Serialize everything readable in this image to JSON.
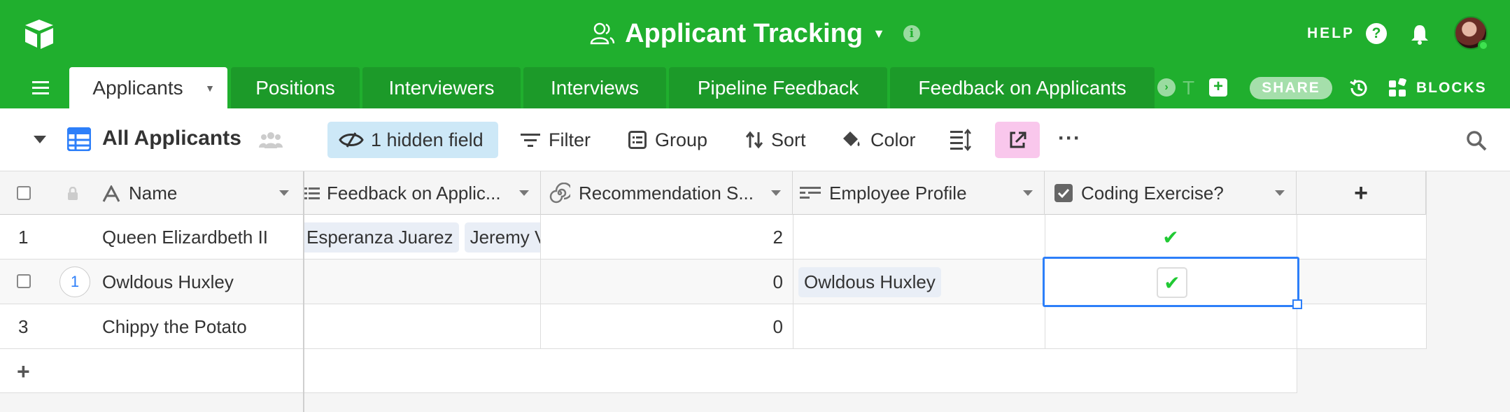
{
  "header": {
    "title": "Applicant Tracking",
    "help_label": "HELP",
    "share_label": "SHARE",
    "blocks_label": "BLOCKS"
  },
  "tabs": [
    {
      "label": "Applicants",
      "active": true
    },
    {
      "label": "Positions"
    },
    {
      "label": "Interviewers"
    },
    {
      "label": "Interviews"
    },
    {
      "label": "Pipeline Feedback"
    },
    {
      "label": "Feedback on Applicants"
    },
    {
      "label": "T"
    }
  ],
  "viewbar": {
    "view_name": "All Applicants",
    "hidden_fields": "1 hidden field",
    "filter": "Filter",
    "group": "Group",
    "sort": "Sort",
    "color": "Color",
    "more": "···"
  },
  "grid": {
    "primary_column": "Name",
    "add_row": "+",
    "add_column": "+",
    "columns": [
      "Feedback on Applic...",
      "Recommendation S...",
      "Employee Profile",
      "Coding Exercise?"
    ],
    "rows": [
      {
        "num": "1",
        "name": "Queen Elizardbeth II",
        "feedback": [
          "Esperanza Juarez",
          "Jeremy V"
        ],
        "recommendation": "2",
        "employee_profile": "",
        "coding_exercise": true
      },
      {
        "num": "1",
        "name": "Owldous Huxley",
        "feedback": [],
        "recommendation": "0",
        "employee_profile": "Owldous Huxley",
        "coding_exercise": true
      },
      {
        "num": "3",
        "name": "Chippy the Potato",
        "feedback": [],
        "recommendation": "0",
        "employee_profile": "",
        "coding_exercise": false
      }
    ]
  },
  "colors": {
    "brand_green": "#20af2e",
    "selection_blue": "#2d7ff9",
    "hidden_field_bg": "#cde8f7",
    "check_green": "#20c933"
  }
}
